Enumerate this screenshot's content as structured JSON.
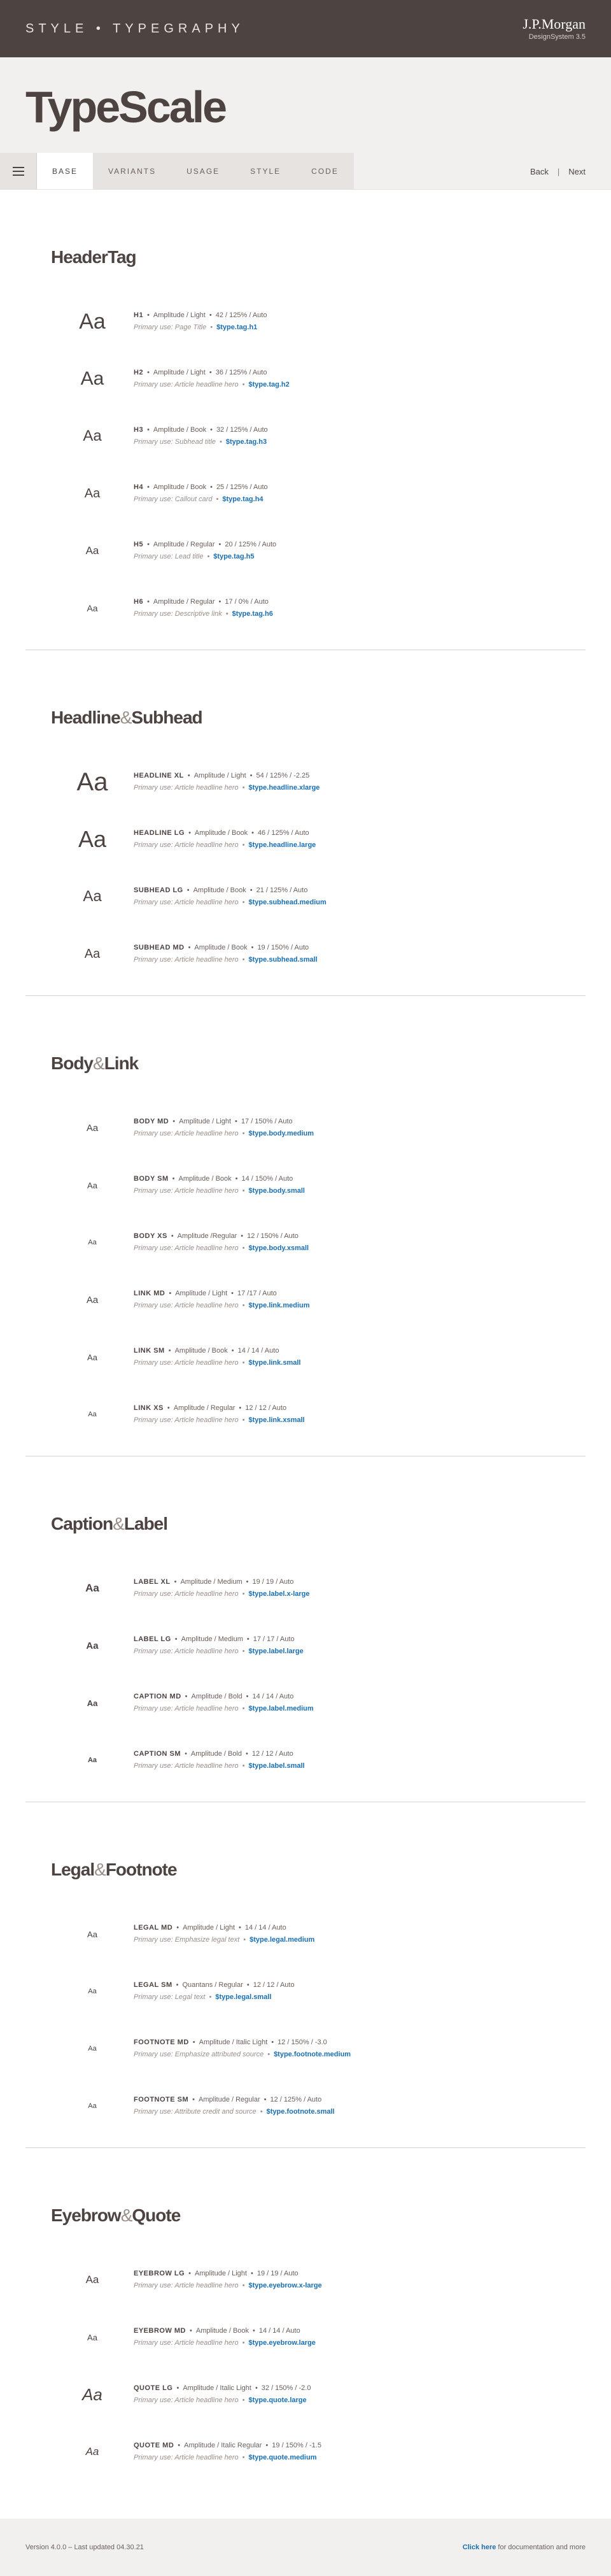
{
  "header": {
    "title": "STYLE • TYPEGRAPHY",
    "brand": "J.P.Morgan",
    "brand_sub": "DesignSystem 3.5"
  },
  "hero": {
    "title": "TypeScale"
  },
  "tabs": [
    "BASE",
    "VARIANTS",
    "USAGE",
    "STYLE",
    "CODE"
  ],
  "nav": {
    "back": "Back",
    "sep": "|",
    "next": "Next"
  },
  "sections": [
    {
      "title_a": "HeaderTag",
      "amp": "",
      "title_b": "",
      "rows": [
        {
          "aa": "Aa",
          "size": 34,
          "name": "H1",
          "spec": "Amplitude / Light",
          "metrics": "42 / 125% / Auto",
          "use": "Primary use: Page Title",
          "token": "$type.tag.h1"
        },
        {
          "aa": "Aa",
          "size": 30,
          "name": "H2",
          "spec": "Amplitude / Light",
          "metrics": "36 / 125% / Auto",
          "use": "Primary use: Article headline hero",
          "token": "$type.tag.h2"
        },
        {
          "aa": "Aa",
          "size": 24,
          "name": "H3",
          "spec": "Amplitude / Book",
          "metrics": "32 / 125% / Auto",
          "use": "Primary use: Subhead title",
          "token": "$type.tag.h3"
        },
        {
          "aa": "Aa",
          "size": 20,
          "name": "H4",
          "spec": "Amplitude / Book",
          "metrics": "25 / 125% / Auto",
          "use": "Primary use: Callout card",
          "token": "$type.tag.h4"
        },
        {
          "aa": "Aa",
          "size": 17,
          "name": "H5",
          "spec": "Amplitude / Regular",
          "metrics": "20 / 125% / Auto",
          "use": "Primary use: Lead title",
          "token": "$type.tag.h5"
        },
        {
          "aa": "Aa",
          "size": 14,
          "name": "H6",
          "spec": "Amplitude / Regular",
          "metrics": "17 / 0% / Auto",
          "use": "Primary use: Descriptive link",
          "token": "$type.tag.h6"
        }
      ]
    },
    {
      "title_a": "Headline",
      "amp": "&",
      "title_b": "Subhead",
      "rows": [
        {
          "aa": "Aa",
          "size": 40,
          "name": "HEADLINE XL",
          "spec": "Amplitude / Light",
          "metrics": "54 / 125% / -2.25",
          "use": "Primary use: Article headline hero",
          "token": "$type.headline.xlarge"
        },
        {
          "aa": "Aa",
          "size": 36,
          "name": "HEADLINE LG",
          "spec": "Amplitude / Book",
          "metrics": "46 / 125% / Auto",
          "use": "Primary use: Article headline hero",
          "token": "$type.headline.large"
        },
        {
          "aa": "Aa",
          "size": 24,
          "name": "SUBHEAD LG",
          "spec": "Amplitude / Book",
          "metrics": "21 / 125% / Auto",
          "use": "Primary use: Article headline hero",
          "token": "$type.subhead.medium"
        },
        {
          "aa": "Aa",
          "size": 20,
          "name": "SUBHEAD MD",
          "spec": "Amplitude / Book",
          "metrics": "19 / 150% / Auto",
          "use": "Primary use: Article headline hero",
          "token": "$type.subhead.small"
        }
      ]
    },
    {
      "title_a": "Body",
      "amp": "&",
      "title_b": "Link",
      "rows": [
        {
          "aa": "Aa",
          "size": 15,
          "name": "BODY MD",
          "spec": "Amplitude / Light",
          "metrics": "17 / 150% / Auto",
          "use": "Primary use: Article headline hero",
          "token": "$type.body.medium"
        },
        {
          "aa": "Aa",
          "size": 13,
          "name": "BODY SM",
          "spec": "Amplitude / Book",
          "metrics": "14 / 150% / Auto",
          "use": "Primary use: Article headline hero",
          "token": "$type.body.small"
        },
        {
          "aa": "Aa",
          "size": 11,
          "name": "BODY XS",
          "spec": "Amplitude /Regular",
          "metrics": "12 / 150% / Auto",
          "use": "Primary use: Article headline hero",
          "token": "$type.body.xsmall"
        },
        {
          "aa": "Aa",
          "size": 15,
          "name": "LINK MD",
          "spec": "Amplitude / Light",
          "metrics": "17 /17 / Auto",
          "use": "Primary use: Article headline hero",
          "token": "$type.link.medium"
        },
        {
          "aa": "Aa",
          "size": 13,
          "name": "LINK SM",
          "spec": "Amplitude / Book",
          "metrics": "14 / 14 / Auto",
          "use": "Primary use: Article headline hero",
          "token": "$type.link.small"
        },
        {
          "aa": "Aa",
          "size": 11,
          "name": "LINK XS",
          "spec": "Amplitude / Regular",
          "metrics": "12 / 12 / Auto",
          "use": "Primary use: Article headline hero",
          "token": "$type.link.xsmall"
        }
      ]
    },
    {
      "title_a": "Caption",
      "amp": "&",
      "title_b": "Label",
      "rows": [
        {
          "aa": "Aa",
          "size": 17,
          "bold": true,
          "name": "LABEL XL",
          "spec": "Amplitude / Medium",
          "metrics": "19 / 19 / Auto",
          "use": "Primary use: Article headline hero",
          "token": "$type.label.x-large"
        },
        {
          "aa": "Aa",
          "size": 15,
          "bold": true,
          "name": "LABEL LG",
          "spec": "Amplitude / Medium",
          "metrics": "17 / 17 / Auto",
          "use": "Primary use: Article headline hero",
          "token": "$type.label.large"
        },
        {
          "aa": "Aa",
          "size": 13,
          "bold": true,
          "name": "CAPTION MD",
          "spec": "Amplitude / Bold",
          "metrics": "14 / 14 / Auto",
          "use": "Primary use: Article headline hero",
          "token": "$type.label.medium"
        },
        {
          "aa": "Aa",
          "size": 11,
          "bold": true,
          "name": "CAPTION SM",
          "spec": "Amplitude / Bold",
          "metrics": "12 / 12 / Auto",
          "use": "Primary use: Article headline hero",
          "token": "$type.label.small"
        }
      ]
    },
    {
      "title_a": "Legal",
      "amp": "&",
      "title_b": "Footnote",
      "rows": [
        {
          "aa": "Aa",
          "size": 13,
          "name": "LEGAL MD",
          "spec": "Amplitude / Light",
          "metrics": "14 / 14 / Auto",
          "use": "Primary use: Emphasize legal text",
          "token": "$type.legal.medium"
        },
        {
          "aa": "Aa",
          "size": 11,
          "name": "LEGAL SM",
          "spec": "Quantans / Regular",
          "metrics": "12 / 12 / Auto",
          "use": "Primary use: Legal text",
          "token": "$type.legal.small"
        },
        {
          "aa": "Aa",
          "size": 11,
          "name": "FOOTNOTE MD",
          "spec": "Amplitude / Italic Light",
          "metrics": "12 / 150% / -3.0",
          "use": "Primary use: Emphasize attributed source",
          "token": "$type.footnote.medium"
        },
        {
          "aa": "Aa",
          "size": 11,
          "name": "FOOTNOTE SM",
          "spec": "Amplitude / Regular",
          "metrics": "12 / 125% / Auto",
          "use": "Primary use: Attribute credit and source",
          "token": "$type.footnote.small"
        }
      ]
    },
    {
      "title_a": "Eyebrow",
      "amp": "&",
      "title_b": "Quote",
      "rows": [
        {
          "aa": "Aa",
          "size": 17,
          "name": "EYEBROW LG",
          "spec": "Amplitude / Light",
          "metrics": "19 / 19 / Auto",
          "use": "Primary use: Article headline hero",
          "token": "$type.eyebrow.x-large"
        },
        {
          "aa": "Aa",
          "size": 13,
          "name": "EYEBROW MD",
          "spec": "Amplitude / Book",
          "metrics": "14 / 14 / Auto",
          "use": "Primary use: Article headline hero",
          "token": "$type.eyebrow.large"
        },
        {
          "aa": "Aa",
          "size": 26,
          "italic": true,
          "name": "QUOTE LG",
          "spec": "Amplitude / Italic Light",
          "metrics": "32 / 150% / -2.0",
          "use": "Primary use: Article headline hero",
          "token": "$type.quote.large"
        },
        {
          "aa": "Aa",
          "size": 17,
          "italic": true,
          "name": "QUOTE MD",
          "spec": "Amplitude / Italic Regular",
          "metrics": "19 / 150% / -1.5",
          "use": "Primary use: Article headline hero",
          "token": "$type.quote.medium"
        }
      ]
    }
  ],
  "footer": {
    "version": "Version 4.0.0 – Last updated 04.30.21",
    "link": "Click here",
    "rest": " for documentation and more"
  }
}
